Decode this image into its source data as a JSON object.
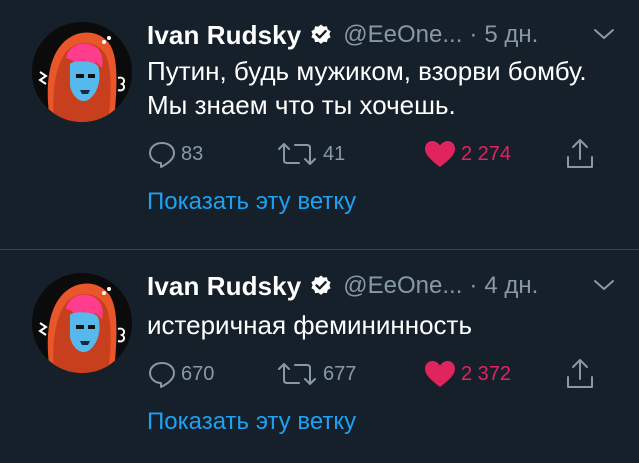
{
  "colors": {
    "background": "#15202b",
    "secondary_text": "#8899a6",
    "link": "#1da1f2",
    "like": "#e0245e",
    "divider": "#38444d"
  },
  "tweets": [
    {
      "name": "Ivan Rudsky",
      "handle": "@EeOne...",
      "separator": "·",
      "time": "5 дн.",
      "text": "Путин, будь мужиком, взорви бомбу. Мы знаем что ты хочешь.",
      "replies": "83",
      "retweets": "41",
      "likes": "2 274",
      "show_thread": "Показать эту ветку",
      "icons": {
        "reply": "reply-icon",
        "retweet": "retweet-icon",
        "like": "heart-icon-filled",
        "share": "share-icon",
        "verified": "verified-badge-icon",
        "menu": "chevron-down-icon"
      }
    },
    {
      "name": "Ivan Rudsky",
      "handle": "@EeOne...",
      "separator": "·",
      "time": "4 дн.",
      "text": "истеричная фемининность",
      "replies": "670",
      "retweets": "677",
      "likes": "2 372",
      "show_thread": "Показать эту ветку",
      "icons": {
        "reply": "reply-icon",
        "retweet": "retweet-icon",
        "like": "heart-icon-filled",
        "share": "share-icon",
        "verified": "verified-badge-icon",
        "menu": "chevron-down-icon"
      }
    }
  ]
}
